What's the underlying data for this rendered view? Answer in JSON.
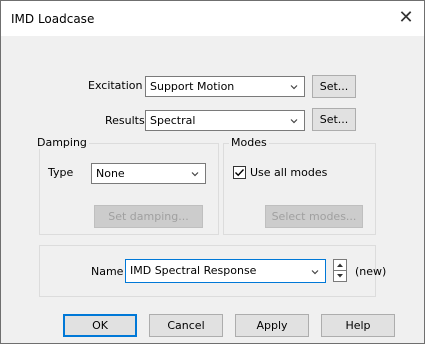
{
  "window": {
    "title": "IMD Loadcase",
    "close_glyph": "✕"
  },
  "excitation": {
    "label": "Excitation",
    "value": "Support Motion",
    "set_label": "Set..."
  },
  "results": {
    "label": "Results",
    "value": "Spectral",
    "set_label": "Set..."
  },
  "damping": {
    "group_title": "Damping",
    "type_label": "Type",
    "type_value": "None",
    "set_damping_label": "Set damping..."
  },
  "modes": {
    "group_title": "Modes",
    "use_all_label": "Use all modes",
    "use_all_checked": true,
    "select_modes_label": "Select modes..."
  },
  "name": {
    "label": "Name",
    "value": "IMD Spectral Response",
    "status": "(new)"
  },
  "buttons": {
    "ok": "OK",
    "cancel": "Cancel",
    "apply": "Apply",
    "help": "Help"
  },
  "icons": {
    "dropdown": "chevron-down-icon",
    "close": "close-icon",
    "check": "checkmark-icon",
    "spin_up": "spin-up-icon",
    "spin_down": "spin-down-icon"
  },
  "colors": {
    "focus_border": "#0078d7",
    "dialog_bg": "#f0f0f0",
    "disabled_text": "#a0a0a0"
  }
}
